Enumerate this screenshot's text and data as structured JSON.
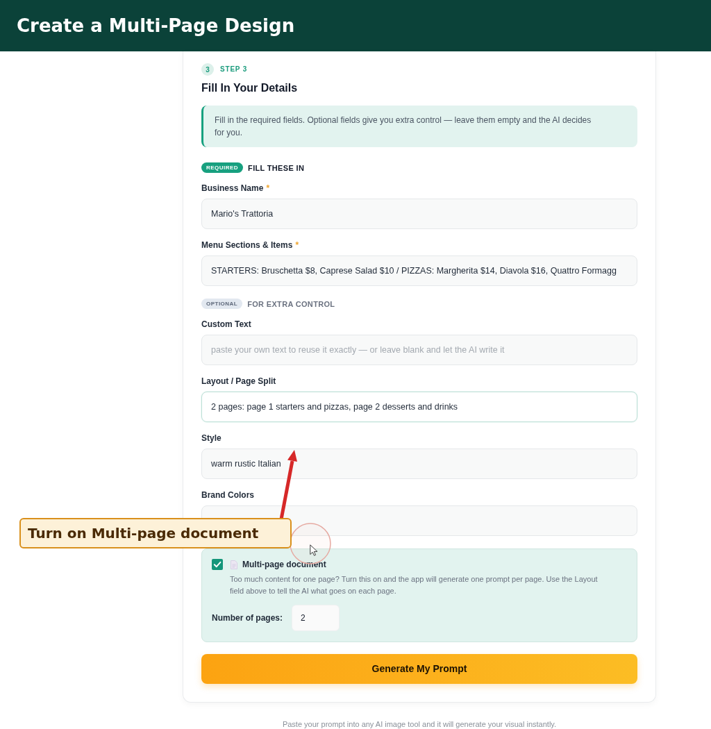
{
  "header": {
    "title": "Create a Multi-Page Design"
  },
  "step": {
    "number": "3",
    "label": "STEP 3",
    "title": "Fill In Your Details"
  },
  "info_note": "Fill in the required fields. Optional fields give you extra control — leave them empty and the AI decides for you.",
  "sections": [
    {
      "kind": "required",
      "tag": "REQUIRED",
      "caption": "FILL THESE IN",
      "fields": [
        {
          "label": "Business Name",
          "required_mark": "*",
          "value": "Mario's Trattoria",
          "focused": false
        },
        {
          "label": "Menu Sections & Items",
          "required_mark": "*",
          "value": "STARTERS: Bruschetta $8, Caprese Salad $10 / PIZZAS: Margherita $14, Diavola $16, Quattro Formagg",
          "focused": false
        }
      ]
    },
    {
      "kind": "optional",
      "tag": "OPTIONAL",
      "caption": "FOR EXTRA CONTROL",
      "fields": [
        {
          "label": "Custom Text",
          "placeholder": "paste your own text to reuse it exactly — or leave blank and let the AI write it",
          "focused": false
        },
        {
          "label": "Layout / Page Split",
          "value": "2 pages: page 1 starters and pizzas, page 2 desserts and drinks",
          "focused": true
        },
        {
          "label": "Style",
          "value": "warm rustic Italian",
          "focused": false
        },
        {
          "label": "Brand Colors",
          "focused": false
        }
      ]
    }
  ],
  "multi_page": {
    "label": "Multi-page document",
    "checked": true,
    "description": "Too much content for one page? Turn this on and the app will generate one prompt per page. Use the Layout field above to tell the AI what goes on each page.",
    "pages_label": "Number of pages:",
    "pages_value": "2"
  },
  "generate_button": "Generate My Prompt",
  "footer_note": "Paste your prompt into any AI image tool and it will generate your visual instantly.",
  "annotation": {
    "text": "Turn on Multi-page document"
  }
}
